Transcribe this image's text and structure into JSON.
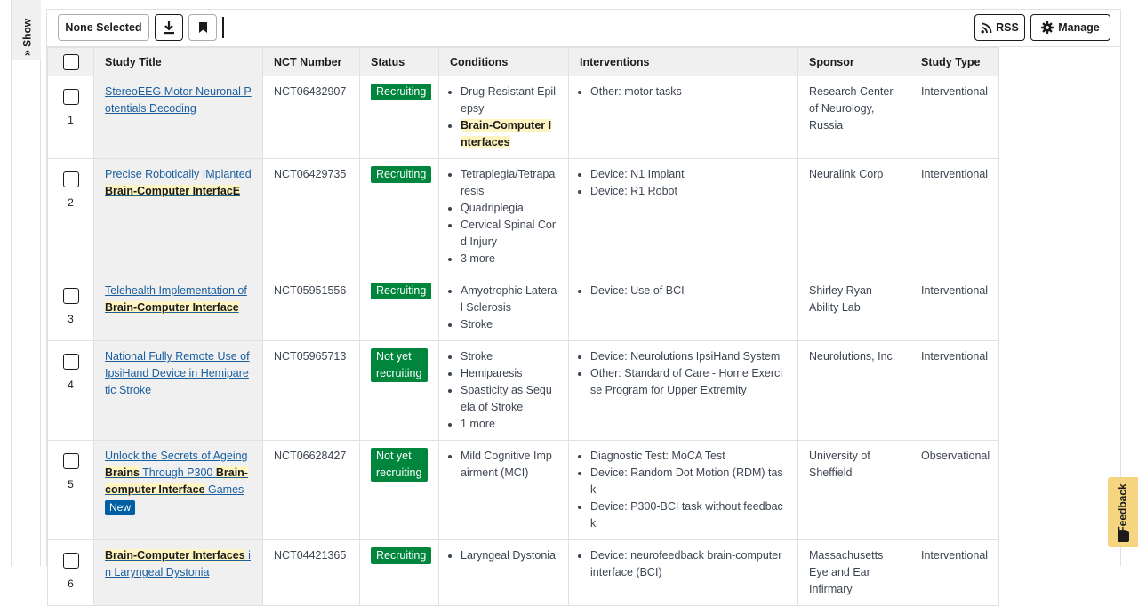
{
  "sidebar": {
    "show_label": "Show",
    "chevron": "»"
  },
  "toolbar": {
    "none_selected": "None Selected",
    "rss": "RSS",
    "manage": "Manage"
  },
  "table": {
    "headers": {
      "title": "Study Title",
      "nct": "NCT Number",
      "status": "Status",
      "conditions": "Conditions",
      "interventions": "Interventions",
      "sponsor": "Sponsor",
      "type": "Study Type"
    },
    "rows": [
      {
        "num": "1",
        "title_parts": [
          {
            "t": "StereoEEG Motor Neuronal Potentials Decoding",
            "h": false
          }
        ],
        "new": false,
        "nct": "NCT06432907",
        "status": "Recruiting",
        "conditions": [
          [
            "Drug Resistant Epilepsy",
            false
          ],
          [
            "Brain-Computer Interfaces",
            true
          ]
        ],
        "interventions": [
          "Other: motor tasks"
        ],
        "sponsor": "Research Center of Neurology, Russia",
        "type": "Interventional"
      },
      {
        "num": "2",
        "title_parts": [
          {
            "t": "Precise Robotically IMplanted ",
            "h": false
          },
          {
            "t": "Brain-Computer InterfacE",
            "h": true
          }
        ],
        "new": false,
        "nct": "NCT06429735",
        "status": "Recruiting",
        "conditions": [
          [
            "Tetraplegia/Tetraparesis",
            false
          ],
          [
            "Quadriplegia",
            false
          ],
          [
            "Cervical Spinal Cord Injury",
            false
          ],
          [
            "3 more",
            false
          ]
        ],
        "interventions": [
          "Device: N1 Implant",
          "Device: R1 Robot"
        ],
        "sponsor": "Neuralink Corp",
        "type": "Interventional"
      },
      {
        "num": "3",
        "title_parts": [
          {
            "t": "Telehealth Implementation of ",
            "h": false
          },
          {
            "t": "Brain-Computer Interface",
            "h": true
          }
        ],
        "new": false,
        "nct": "NCT05951556",
        "status": "Recruiting",
        "conditions": [
          [
            "Amyotrophic Lateral Sclerosis",
            false
          ],
          [
            "Stroke",
            false
          ]
        ],
        "interventions": [
          "Device: Use of BCI"
        ],
        "sponsor": "Shirley Ryan Ability Lab",
        "type": "Interventional"
      },
      {
        "num": "4",
        "title_parts": [
          {
            "t": "National Fully Remote Use of IpsiHand Device in Hemiparetic Stroke",
            "h": false
          }
        ],
        "new": false,
        "nct": "NCT05965713",
        "status": "Not yet recruiting",
        "conditions": [
          [
            "Stroke",
            false
          ],
          [
            "Hemiparesis",
            false
          ],
          [
            "Spasticity as Sequela of Stroke",
            false
          ],
          [
            "1 more",
            false
          ]
        ],
        "interventions": [
          "Device: Neurolutions IpsiHand System",
          "Other: Standard of Care - Home Exercise Program for Upper Extremity"
        ],
        "sponsor": "Neurolutions, Inc.",
        "type": "Interventional"
      },
      {
        "num": "5",
        "title_parts": [
          {
            "t": "Unlock the Secrets of Ageing ",
            "h": false
          },
          {
            "t": "Brains",
            "h": true
          },
          {
            "t": " Through P300 ",
            "h": false
          },
          {
            "t": "Brain-computer Interface",
            "h": true
          },
          {
            "t": " Games",
            "h": false
          }
        ],
        "new": true,
        "new_label": "New",
        "nct": "NCT06628427",
        "status": "Not yet recruiting",
        "conditions": [
          [
            "Mild Cognitive Impairment (MCI)",
            false
          ]
        ],
        "interventions": [
          "Diagnostic Test: MoCA Test",
          "Device: Random Dot Motion (RDM) task",
          "Device: P300-BCI task without feedback"
        ],
        "sponsor": "University of Sheffield",
        "type": "Observational"
      },
      {
        "num": "6",
        "title_parts": [
          {
            "t": "Brain-Computer Interfaces",
            "h": true
          },
          {
            "t": " in Laryngeal Dystonia",
            "h": false
          }
        ],
        "new": false,
        "nct": "NCT04421365",
        "status": "Recruiting",
        "conditions": [
          [
            "Laryngeal Dystonia",
            false
          ]
        ],
        "interventions": [
          "Device: neurofeedback brain-computer interface (BCI)"
        ],
        "sponsor": "Massachusetts Eye and Ear Infirmary",
        "type": "Interventional"
      }
    ]
  },
  "feedback": {
    "label": "Feedback",
    "color": "#f5d580"
  },
  "colors": {
    "recruiting": "#00853c",
    "new_badge": "#005ea2",
    "link": "#1a5e9f",
    "highlight": "#fff5c2"
  }
}
